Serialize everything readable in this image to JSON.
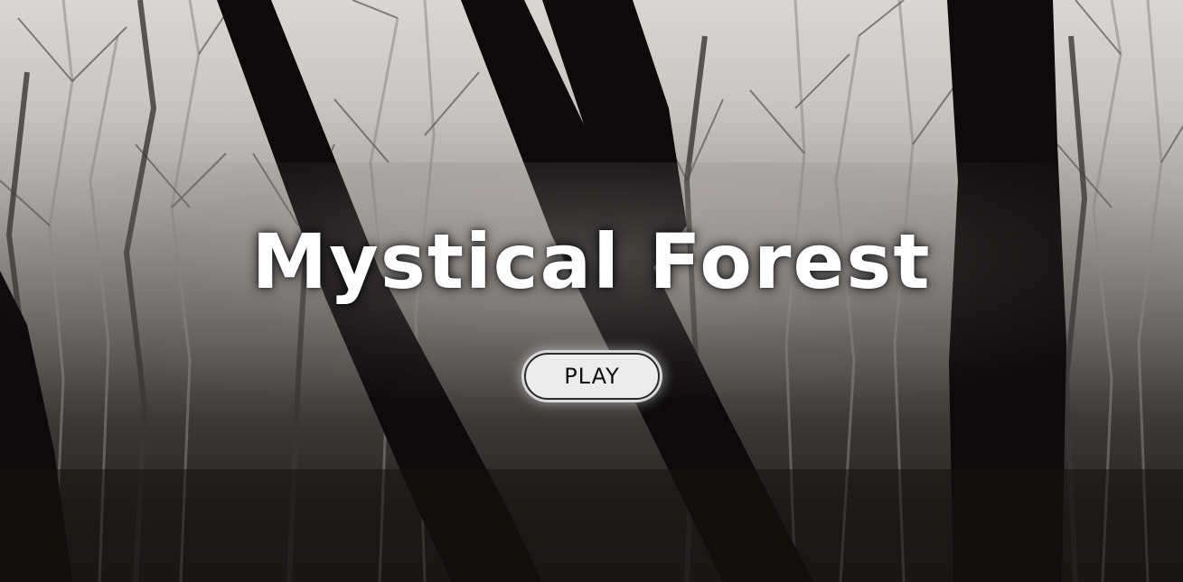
{
  "game": {
    "title": "Mystical Forest",
    "play_label": "PLAY"
  },
  "colors": {
    "title_text": "#ffffff",
    "button_bg": "#ececec",
    "button_text": "#111111",
    "tree_trunks": "#0c0a0a"
  }
}
